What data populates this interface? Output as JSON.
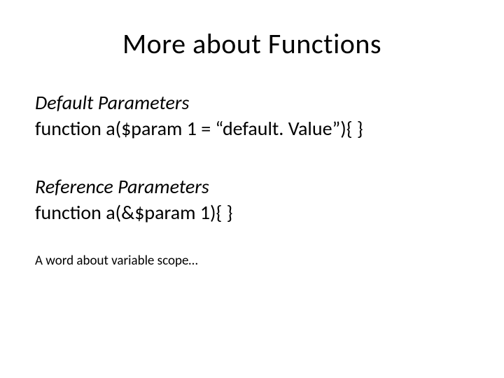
{
  "slide": {
    "title": "More about Functions",
    "section1": {
      "heading": "Default Parameters",
      "code": "function a($param 1 = “default. Value”){ }"
    },
    "section2": {
      "heading": "Reference Parameters",
      "code": "function a(&$param 1){ }"
    },
    "footnote": "A word about variable scope…"
  }
}
